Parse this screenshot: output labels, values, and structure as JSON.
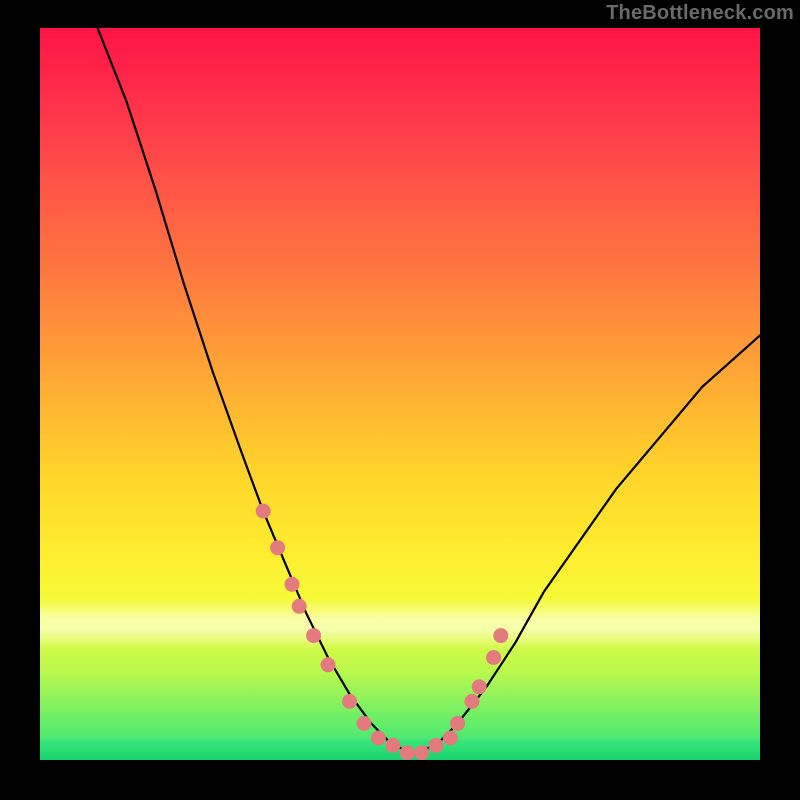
{
  "watermark": "TheBottleneck.com",
  "colors": {
    "frame_bg": "#000000",
    "curve": "#000000",
    "marker": "#e37a7e",
    "gradient_stops": [
      "#ff1445",
      "#ff5048",
      "#ffa935",
      "#ffd22a",
      "#fdee2f",
      "#b9f84d",
      "#28e07c"
    ]
  },
  "chart_data": {
    "type": "line",
    "title": "",
    "xlabel": "",
    "ylabel": "",
    "xlim": [
      0,
      100
    ],
    "ylim": [
      0,
      100
    ],
    "grid": false,
    "legend": null,
    "series": [
      {
        "name": "bottleneck-curve",
        "x": [
          8,
          12,
          16,
          20,
          24,
          28,
          31,
          34,
          37,
          40,
          43,
          46,
          49,
          52,
          55,
          58,
          62,
          66,
          70,
          75,
          80,
          86,
          92,
          100
        ],
        "y": [
          100,
          90,
          78,
          65,
          53,
          42,
          34,
          27,
          20,
          14,
          9,
          5,
          2,
          1,
          2,
          5,
          10,
          16,
          23,
          30,
          37,
          44,
          51,
          58
        ]
      }
    ],
    "markers": {
      "name": "series-markers",
      "x": [
        31,
        33,
        35,
        36,
        38,
        40,
        43,
        45,
        47,
        49,
        51,
        53,
        55,
        57,
        58,
        60,
        61,
        63,
        64
      ],
      "y": [
        34,
        29,
        24,
        21,
        17,
        13,
        8,
        5,
        3,
        2,
        1,
        1,
        2,
        3,
        5,
        8,
        10,
        14,
        17
      ]
    }
  }
}
